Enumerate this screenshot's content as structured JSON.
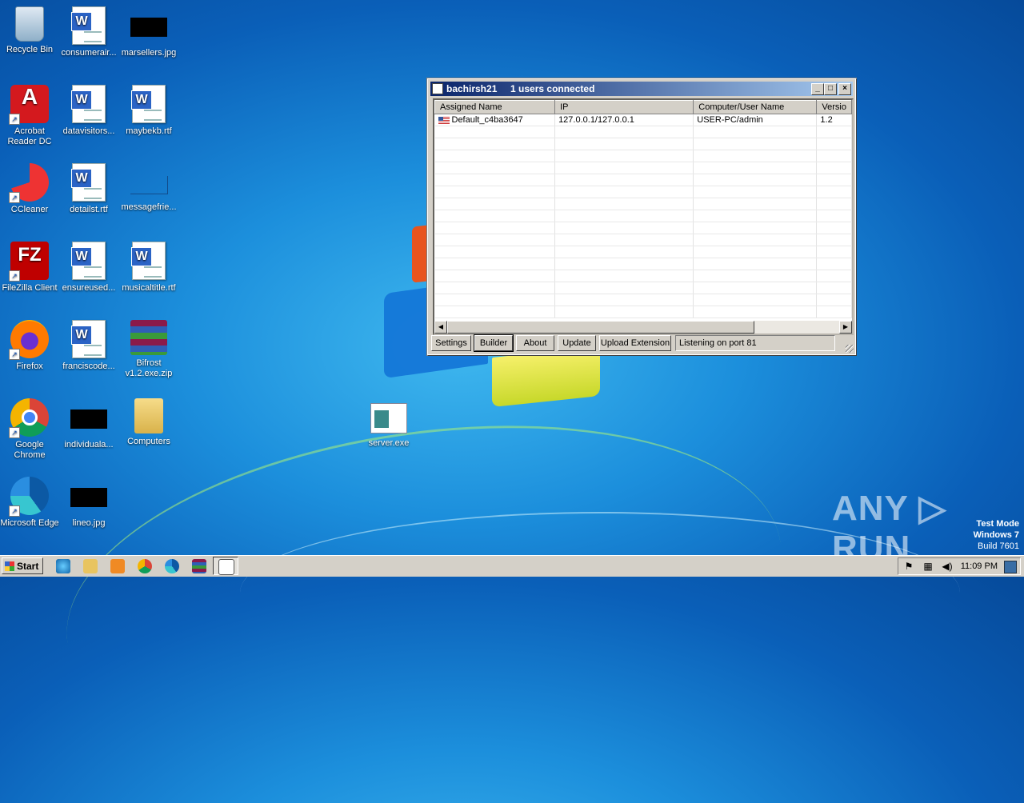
{
  "desktop": {
    "icons": [
      {
        "label": "Recycle Bin",
        "icon": "recycle-bin-icon"
      },
      {
        "label": "consumerair...",
        "icon": "word-doc-icon"
      },
      {
        "label": "marsellers.jpg",
        "icon": "image-file-icon"
      },
      {
        "label": "Acrobat Reader DC",
        "icon": "acrobat-icon"
      },
      {
        "label": "datavisitors...",
        "icon": "word-doc-icon"
      },
      {
        "label": "maybekb.rtf",
        "icon": "word-doc-icon"
      },
      {
        "label": "CCleaner",
        "icon": "ccleaner-icon"
      },
      {
        "label": "detailst.rtf",
        "icon": "word-doc-icon"
      },
      {
        "label": "messagefrie...",
        "icon": "blank-file-icon"
      },
      {
        "label": "FileZilla Client",
        "icon": "filezilla-icon"
      },
      {
        "label": "ensureused...",
        "icon": "word-doc-icon"
      },
      {
        "label": "musicaltitle.rtf",
        "icon": "word-doc-icon"
      },
      {
        "label": "Firefox",
        "icon": "firefox-icon"
      },
      {
        "label": "franciscode...",
        "icon": "word-doc-icon"
      },
      {
        "label": "Bifrost v1.2.exe.zip",
        "icon": "winrar-icon"
      },
      {
        "label": "Google Chrome",
        "icon": "chrome-icon"
      },
      {
        "label": "individuala...",
        "icon": "image-file-icon"
      },
      {
        "label": "Computers",
        "icon": "folder-icon"
      },
      {
        "label": "server.exe",
        "icon": "exe-icon"
      },
      {
        "label": "Microsoft Edge",
        "icon": "edge-icon"
      },
      {
        "label": "lineo.jpg",
        "icon": "image-file-icon"
      }
    ]
  },
  "window": {
    "title": "bachirsh21     1 users connected",
    "columns": [
      "Assigned Name",
      "IP",
      "Computer/User Name",
      "Versio"
    ],
    "rows": [
      {
        "name": "Default_c4ba3647",
        "ip": "127.0.0.1/127.0.0.1",
        "user": "USER-PC/admin",
        "version": "1.2"
      }
    ],
    "buttons": [
      "Settings",
      "Builder",
      "About",
      "Update",
      "Upload Extension"
    ],
    "status": "Listening on port 81"
  },
  "taskbar": {
    "start_label": "Start",
    "clock": "11:09 PM"
  },
  "watermark": {
    "brand": "ANY ▷ RUN",
    "line1": "Test Mode",
    "line2": "Windows 7",
    "line3": "Build 7601"
  }
}
